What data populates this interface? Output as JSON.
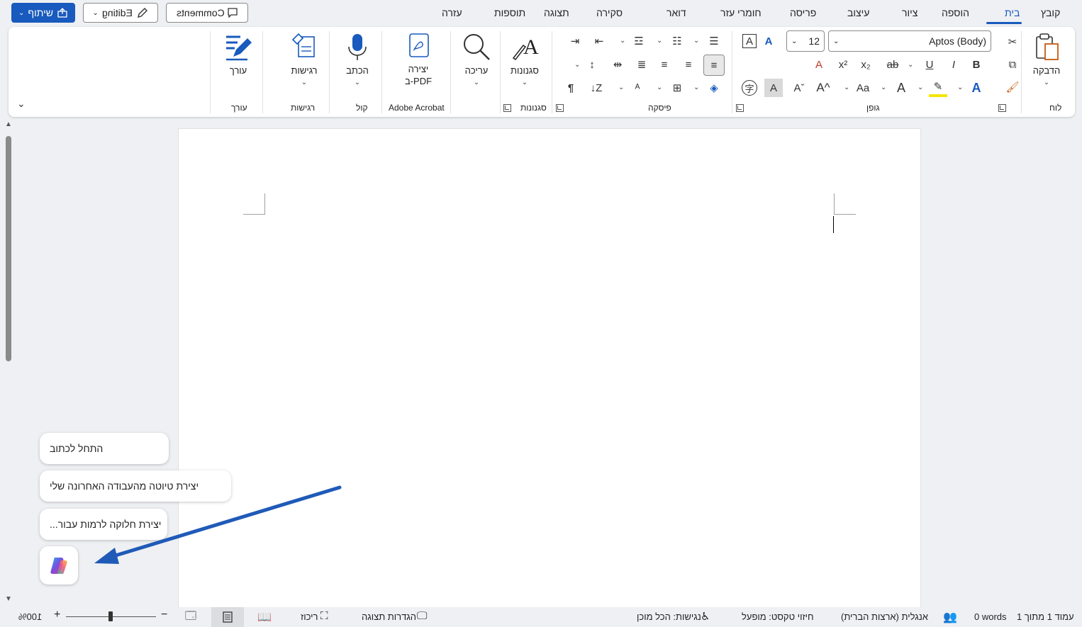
{
  "tabs": [
    {
      "label": "קובץ",
      "active": false
    },
    {
      "label": "בית",
      "active": true
    },
    {
      "label": "ציור",
      "active": false
    },
    {
      "label": "הוספה",
      "active": false
    },
    {
      "label": "עיצוב",
      "active": false
    },
    {
      "label": "פריסה",
      "active": false
    },
    {
      "label": "חומרי עזר",
      "active": false
    },
    {
      "label": "דואר",
      "active": false
    },
    {
      "label": "סקירה",
      "active": false
    },
    {
      "label": "תצוגה",
      "active": false
    },
    {
      "label": "תוספות",
      "active": false
    },
    {
      "label": "עזרה",
      "active": false
    }
  ],
  "toolbar": {
    "comments_label": "Comments",
    "editing_label": "Editing",
    "share_label": "שיתוף"
  },
  "ribbon": {
    "clipboard": {
      "group_label": "לוח",
      "paste_label": "הדבקה"
    },
    "font": {
      "group_label": "גופן",
      "font_name": "Aptos (Body)",
      "font_size": "12"
    },
    "paragraph": {
      "group_label": "פיסקה"
    },
    "styles": {
      "group_label": "סגנונות",
      "button_label": "סגנונות"
    },
    "editing": {
      "button_label": "עריכה"
    },
    "acrobat": {
      "group_label": "Adobe Acrobat",
      "button_label_1": "יצירה",
      "button_label_2": "PDF-ב"
    },
    "voice": {
      "group_label": "קול",
      "button_label": "הכתב"
    },
    "sensitivity": {
      "group_label": "רגישות",
      "button_label": "רגישות"
    },
    "editor": {
      "group_label": "עורך",
      "button_label": "עורך"
    }
  },
  "copilot": {
    "suggestions": [
      "התחל לכתוב",
      "יצירת טיוטה מהעבודה האחרונה שלי",
      "יצירת חלוקה לרמות עבור..."
    ]
  },
  "status": {
    "page": "עמוד 1 מתוך 1",
    "words": "0 words",
    "language": "אנגלית (ארצות הברית)",
    "text_prediction": "חיזוי טקסט: מופעל",
    "accessibility": "נגישות: הכל מוכן",
    "display_settings": "הגדרות תצוגה",
    "focus": "ריכוז",
    "zoom": "100%"
  },
  "colors": {
    "accent": "#185abd",
    "arrow": "#1f5ab8"
  }
}
